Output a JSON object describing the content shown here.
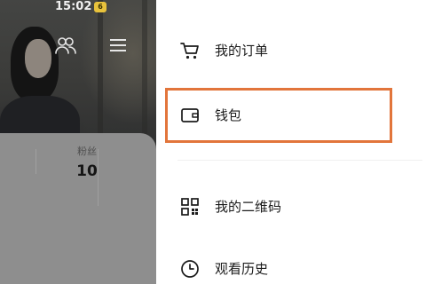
{
  "status_bar": {
    "time": "15:02",
    "badge": "6"
  },
  "profile": {
    "header_icons": [
      "friends-icon",
      "menu-icon"
    ],
    "stats": {
      "fans_label": "粉丝",
      "fans_count": "10"
    }
  },
  "drawer": {
    "items": [
      {
        "label": "我的订单",
        "icon": "cart-icon"
      },
      {
        "label": "钱包",
        "icon": "wallet-icon"
      },
      {
        "label": "我的二维码",
        "icon": "qrcode-icon"
      },
      {
        "label": "观看历史",
        "icon": "clock-icon"
      }
    ]
  },
  "colors": {
    "highlight": "#e2753b",
    "text": "#1b1b1b",
    "dim_overlay": "#8e8e8e"
  }
}
